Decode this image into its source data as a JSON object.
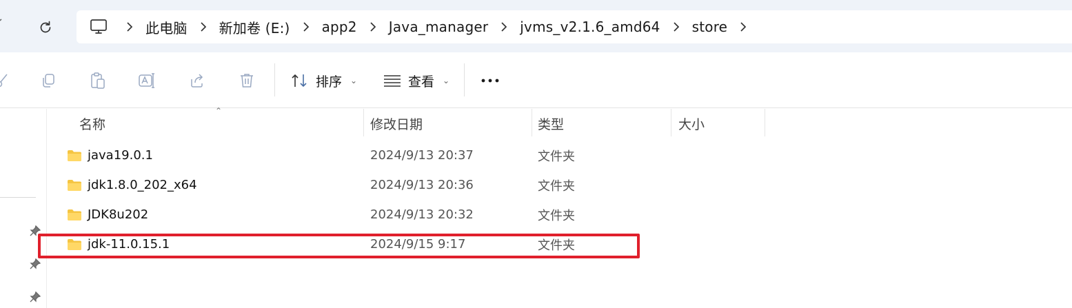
{
  "breadcrumb": [
    "此电脑",
    "新加卷 (E:)",
    "app2",
    "Java_manager",
    "jvms_v2.1.6_amd64",
    "store"
  ],
  "toolbar": {
    "sort_label": "排序",
    "view_label": "查看",
    "more_label": "•••"
  },
  "columns": {
    "name": "名称",
    "modified": "修改日期",
    "type": "类型",
    "size": "大小"
  },
  "files": [
    {
      "name": "java19.0.1",
      "modified": "2024/9/13 20:37",
      "type": "文件夹",
      "size": ""
    },
    {
      "name": "jdk1.8.0_202_x64",
      "modified": "2024/9/13 20:36",
      "type": "文件夹",
      "size": ""
    },
    {
      "name": "JDK8u202",
      "modified": "2024/9/13 20:32",
      "type": "文件夹",
      "size": ""
    },
    {
      "name": "jdk-11.0.15.1",
      "modified": "2024/9/15 9:17",
      "type": "文件夹",
      "size": ""
    }
  ],
  "highlighted_file": "jdk-11.0.15.1",
  "colors": {
    "highlight": "#e0202c",
    "folder": "#f5c542",
    "address_bg": "#eff3f9",
    "command_icon": "#4a6fa5"
  },
  "icons": [
    "refresh-icon",
    "computer-icon",
    "cut-icon",
    "copy-icon",
    "paste-icon",
    "rename-icon",
    "share-icon",
    "delete-icon",
    "sort-icon",
    "view-icon",
    "more-icon",
    "pin-icon",
    "folder-icon"
  ]
}
